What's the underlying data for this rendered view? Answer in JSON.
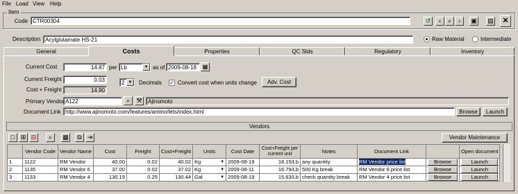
{
  "menu": [
    "File",
    "Load",
    "View",
    "Help"
  ],
  "item_group_label": "Item",
  "code_label": "Code",
  "code_value": "CTR00304",
  "description_label": "Description",
  "description_value": "Acylglutamate HS-21",
  "material_type": {
    "raw": "Raw Material",
    "intermediate": "Intermediate",
    "selected": "raw"
  },
  "tabs": [
    "General",
    "Costs",
    "Properties",
    "QC Stds",
    "Regulatory",
    "Inventory"
  ],
  "active_tab": "Costs",
  "costs": {
    "current_cost_label": "Current Cost",
    "current_cost": "14.87",
    "per_label": "per",
    "per_unit": "Lb",
    "as_of_label": "as of",
    "as_of_date": "2009-08-18",
    "current_freight_label": "Current Freight",
    "current_freight": "0.03",
    "decimals_value": "2",
    "decimals_label": "Decimals",
    "convert_label": "Convert cost when units change",
    "convert_checked": true,
    "adv_cost_label": "Adv. Cost",
    "cost_freight_label": "Cost + Freight",
    "cost_freight": "14.90",
    "primary_vendor_label": "Primary Vendor",
    "primary_vendor_code": "A122",
    "primary_vendor_name": "Ajinomoto",
    "document_link_label": "Document Link",
    "document_link": "http://www.ajinomoto.com/features/amino/lets/index.html",
    "browse_label": "Browse",
    "launch_label": "Launch"
  },
  "vendors_header": "Vendors",
  "vendor_maintenance_label": "Vendor Maintenance",
  "grid": {
    "columns": [
      "",
      "Vendor Code",
      "Vendor Name",
      "Cost",
      "Freight",
      "Cost+Freight",
      "Units",
      "Cost Date",
      "Cost+Freight per current unit",
      "Notes",
      "Document Link",
      "",
      "Open document"
    ],
    "rows": [
      {
        "n": "1",
        "code": "1122",
        "name": "RM Vendor",
        "cost": "40.00",
        "freight": "0.02",
        "cf": "40.02",
        "units": "Kg",
        "date": "2009-08-19",
        "per_unit": "18.15/Lb",
        "notes": "any quantity",
        "doc": "RM Vendor price list",
        "browse": "Browse",
        "launch": "Launch"
      },
      {
        "n": "2",
        "code": "1135",
        "name": "RM Vendor 6",
        "cost": "37.00",
        "freight": "0.02",
        "cf": "37.02",
        "units": "Kg",
        "date": "2009-08-11",
        "per_unit": "16.79/Lb",
        "notes": "500 Kg break",
        "doc": "RM Vendor 6 price list",
        "browse": "Browse",
        "launch": "Launch"
      },
      {
        "n": "3",
        "code": "1133",
        "name": "RM Vendor 4",
        "cost": "130.19",
        "freight": "0.25",
        "cf": "130.44",
        "units": "Gal",
        "date": "2009-08-19",
        "per_unit": "15.63/Lb",
        "notes": "check quantity break",
        "doc": "RM Vendor 4 price list",
        "browse": "Browse",
        "launch": "Launch"
      }
    ]
  }
}
